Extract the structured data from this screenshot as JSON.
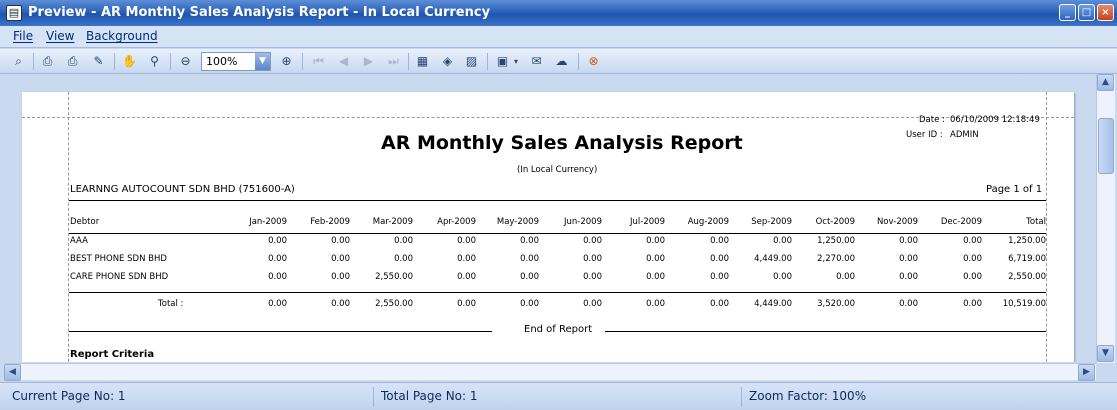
{
  "window": {
    "title": "Preview - AR Monthly Sales Analysis Report - In Local Currency",
    "app_icon": "report-preview-icon",
    "minimize_glyph": "_",
    "maximize_glyph": "□",
    "close_glyph": "×"
  },
  "menu": {
    "file": "File",
    "view": "View",
    "background": "Background"
  },
  "toolbar": {
    "zoom_value": "100%",
    "icons": [
      "find-icon",
      "print-setup-icon",
      "print-icon",
      "export-icon",
      "hand-tool-icon",
      "magnifier-icon",
      "zoom-out-icon",
      "zoom-in-icon",
      "first-page-icon",
      "previous-page-icon",
      "next-page-icon",
      "last-page-icon",
      "multiple-pages-icon",
      "page-color-icon",
      "watermark-icon",
      "export-document-icon",
      "email-icon",
      "open-icon",
      "exit-icon"
    ]
  },
  "report": {
    "date_label": "Date :",
    "date_value": "06/10/2009 12:18:49",
    "user_label": "User ID :",
    "user_value": "ADMIN",
    "title": "AR Monthly Sales Analysis Report",
    "subtitle": "(In Local Currency)",
    "company": "LEARNNG AUTOCOUNT SDN BHD (751600-A)",
    "page_info": "Page 1 of 1",
    "columns": [
      "Debtor",
      "Jan-2009",
      "Feb-2009",
      "Mar-2009",
      "Apr-2009",
      "May-2009",
      "Jun-2009",
      "Jul-2009",
      "Aug-2009",
      "Sep-2009",
      "Oct-2009",
      "Nov-2009",
      "Dec-2009",
      "Total"
    ],
    "rows": [
      {
        "debtor": "AAA",
        "values": [
          "0.00",
          "0.00",
          "0.00",
          "0.00",
          "0.00",
          "0.00",
          "0.00",
          "0.00",
          "0.00",
          "1,250.00",
          "0.00",
          "0.00",
          "1,250.00"
        ]
      },
      {
        "debtor": "BEST PHONE SDN BHD",
        "values": [
          "0.00",
          "0.00",
          "0.00",
          "0.00",
          "0.00",
          "0.00",
          "0.00",
          "0.00",
          "4,449.00",
          "2,270.00",
          "0.00",
          "0.00",
          "6,719.00"
        ]
      },
      {
        "debtor": "CARE PHONE SDN BHD",
        "values": [
          "0.00",
          "0.00",
          "2,550.00",
          "0.00",
          "0.00",
          "0.00",
          "0.00",
          "0.00",
          "0.00",
          "0.00",
          "0.00",
          "0.00",
          "2,550.00"
        ]
      }
    ],
    "total_label": "Total :",
    "totals": [
      "0.00",
      "0.00",
      "2,550.00",
      "0.00",
      "0.00",
      "0.00",
      "0.00",
      "0.00",
      "4,449.00",
      "3,520.00",
      "0.00",
      "0.00",
      "10,519.00"
    ],
    "end_text": "End of Report",
    "criteria_heading": "Report Criteria"
  },
  "status": {
    "current_page": "Current Page No: 1",
    "total_page": "Total Page No: 1",
    "zoom_factor": "Zoom Factor: 100%"
  }
}
